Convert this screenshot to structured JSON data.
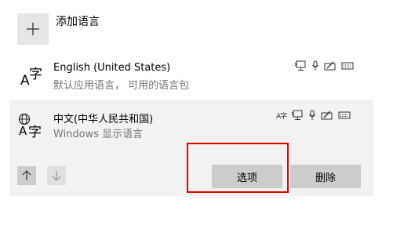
{
  "add_language": {
    "label": "添加语言",
    "icon": "plus-icon"
  },
  "languages": [
    {
      "name": "English (United States)",
      "subtitle": "默认应用语言， 可用的语言包",
      "icon": "language-icon",
      "icon_glyph_top": "字",
      "icon_glyph_bottom": "A",
      "features": [
        "text-to-speech-icon",
        "speech-recognition-icon",
        "handwriting-icon",
        "keyboard-icon"
      ]
    },
    {
      "name": "中文(中华人民共和国)",
      "subtitle": "Windows 显示语言",
      "icon": "display-language-icon",
      "icon_glyph_top": "字",
      "icon_glyph_bottom": "A",
      "features": [
        "language-pack-icon",
        "text-to-speech-icon",
        "speech-recognition-icon",
        "handwriting-icon",
        "keyboard-icon"
      ],
      "feature_lang_glyph": "A字"
    }
  ],
  "controls": {
    "move_up_icon": "arrow-up-icon",
    "move_down_icon": "arrow-down-icon",
    "options_label": "选项",
    "remove_label": "删除"
  },
  "colors": {
    "selected_background": "#f2f2f2",
    "button_background": "#cccccc",
    "highlight": "#e60000",
    "subtitle_text": "#767676"
  }
}
